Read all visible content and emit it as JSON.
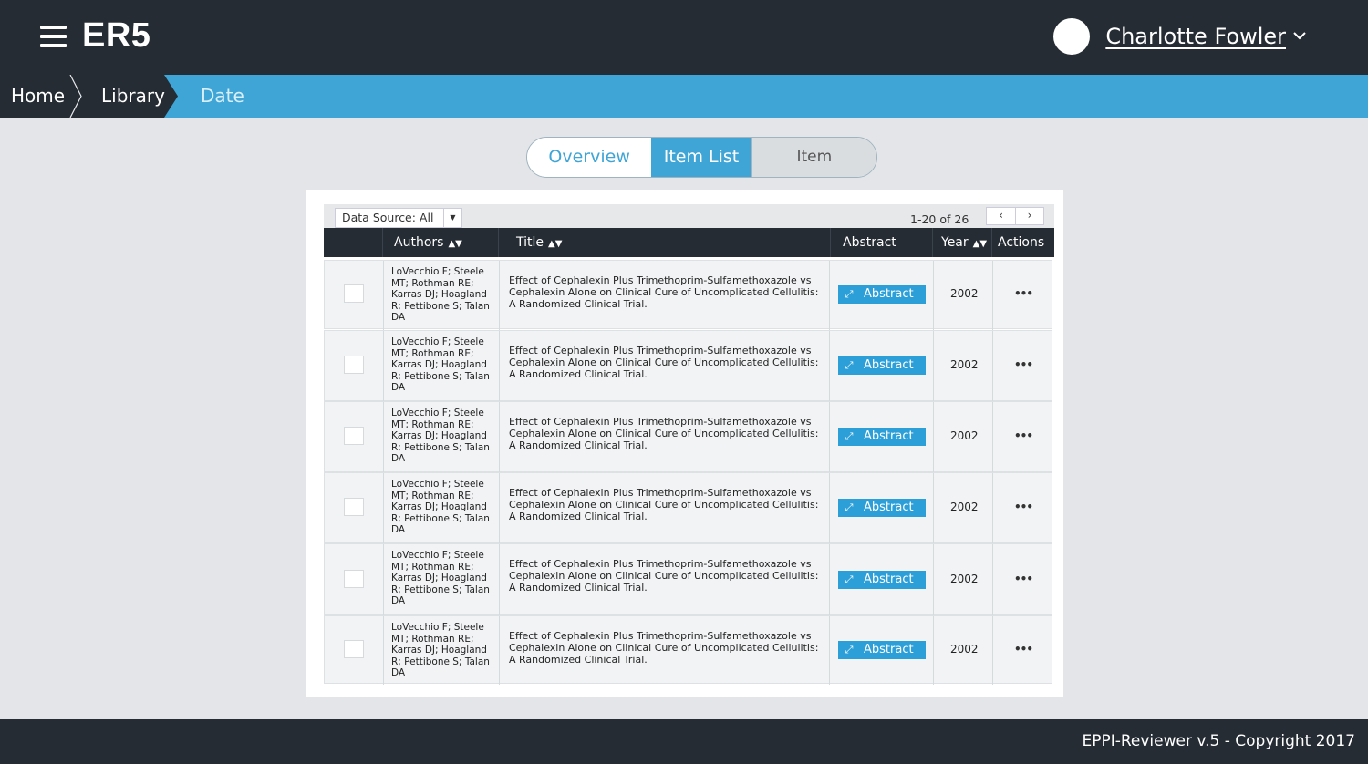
{
  "header": {
    "brand": "ER5",
    "user_name": "Charlotte Fowler"
  },
  "breadcrumb": [
    "Home",
    "Library",
    "Date"
  ],
  "tabs": [
    {
      "label": "Overview",
      "active": false
    },
    {
      "label": "Item List",
      "active": true
    },
    {
      "label": "Item",
      "active": false
    }
  ],
  "toolbar": {
    "data_source": "Data Source: All",
    "pager_text": "1-20 of 26",
    "prev": "‹",
    "next": "›"
  },
  "table": {
    "columns": [
      "Authors",
      "Title",
      "Abstract",
      "Year",
      "Actions"
    ],
    "rows": [
      {
        "authors": "LoVecchio F; Steele MT; Rothman RE; Karras DJ; Hoagland R; Pettibone S; Talan DA",
        "title": "Effect of Cephalexin Plus Trimethoprim-Sulfamethoxazole vs Cephalexin Alone on Clinical Cure of Uncomplicated Cellulitis: A Randomized Clinical Trial.",
        "abstract": "Abstract",
        "year": "2002",
        "actions": "•••"
      },
      {
        "authors": "LoVecchio F; Steele MT; Rothman RE; Karras DJ; Hoagland R; Pettibone S; Talan DA",
        "title": "Effect of Cephalexin Plus Trimethoprim-Sulfamethoxazole vs Cephalexin Alone on Clinical Cure of Uncomplicated Cellulitis: A Randomized Clinical Trial.",
        "abstract": "Abstract",
        "year": "2002",
        "actions": "•••"
      },
      {
        "authors": "LoVecchio F; Steele MT; Rothman RE; Karras DJ; Hoagland R; Pettibone S; Talan DA",
        "title": "Effect of Cephalexin Plus Trimethoprim-Sulfamethoxazole vs Cephalexin Alone on Clinical Cure of Uncomplicated Cellulitis: A Randomized Clinical Trial.",
        "abstract": "Abstract",
        "year": "2002",
        "actions": "•••"
      },
      {
        "authors": "LoVecchio F; Steele MT; Rothman RE; Karras DJ; Hoagland R; Pettibone S; Talan DA",
        "title": "Effect of Cephalexin Plus Trimethoprim-Sulfamethoxazole vs Cephalexin Alone on Clinical Cure of Uncomplicated Cellulitis: A Randomized Clinical Trial.",
        "abstract": "Abstract",
        "year": "2002",
        "actions": "•••"
      },
      {
        "authors": "LoVecchio F; Steele MT; Rothman RE; Karras DJ; Hoagland R; Pettibone S; Talan DA",
        "title": "Effect of Cephalexin Plus Trimethoprim-Sulfamethoxazole vs Cephalexin Alone on Clinical Cure of Uncomplicated Cellulitis: A Randomized Clinical Trial.",
        "abstract": "Abstract",
        "year": "2002",
        "actions": "•••"
      },
      {
        "authors": "LoVecchio F; Steele MT; Rothman RE; Karras DJ; Hoagland R; Pettibone S; Talan DA",
        "title": "Effect of Cephalexin Plus Trimethoprim-Sulfamethoxazole vs Cephalexin Alone on Clinical Cure of Uncomplicated Cellulitis: A Randomized Clinical Trial.",
        "abstract": "Abstract",
        "year": "2002",
        "actions": "•••"
      }
    ]
  },
  "footer": {
    "text": "EPPI-Reviewer v.5 - Copyright 2017"
  },
  "colors": {
    "dark": "#252c34",
    "accent": "#3ea5d6",
    "button": "#2d9fd8"
  }
}
